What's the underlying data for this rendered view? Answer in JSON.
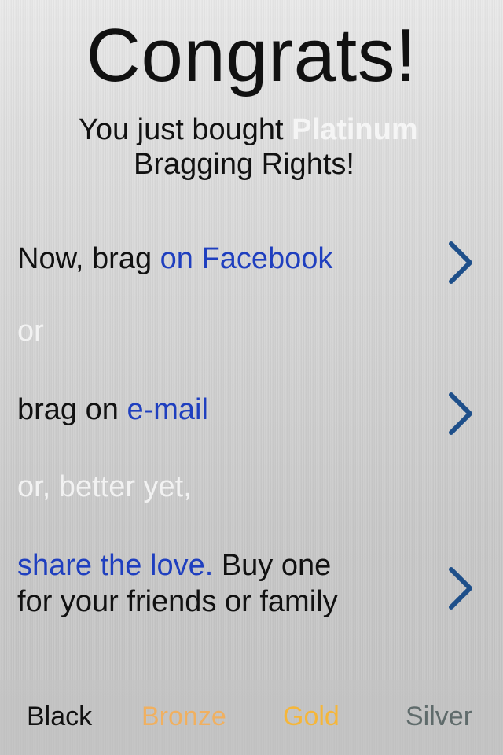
{
  "header": {
    "title": "Congrats!",
    "subtitle_prefix": "You just bought",
    "subtitle_highlight": "Platinum",
    "subtitle_line2": "Bragging Rights!"
  },
  "actions": {
    "facebook": {
      "prefix": "Now, brag",
      "link": "on Facebook",
      "chevron_icon": "chevron-right-icon"
    },
    "or1": "or",
    "email": {
      "prefix": "brag on",
      "link": "e-mail",
      "chevron_icon": "chevron-right-icon"
    },
    "or2": "or, better yet,",
    "gift": {
      "link": "share the love.",
      "text1": "Buy one",
      "text2": "for your friends or family",
      "chevron_icon": "chevron-right-icon"
    }
  },
  "tiers": [
    {
      "label": "Black",
      "color": "#111111"
    },
    {
      "label": "Bronze",
      "color": "#f0b060"
    },
    {
      "label": "Gold",
      "color": "#f5b63a"
    },
    {
      "label": "Silver",
      "color": "#5f6b6b"
    }
  ],
  "colors": {
    "link": "#1f3fbf",
    "chevron": "#1e4f8a",
    "muted_text": "#f2f2f2"
  }
}
